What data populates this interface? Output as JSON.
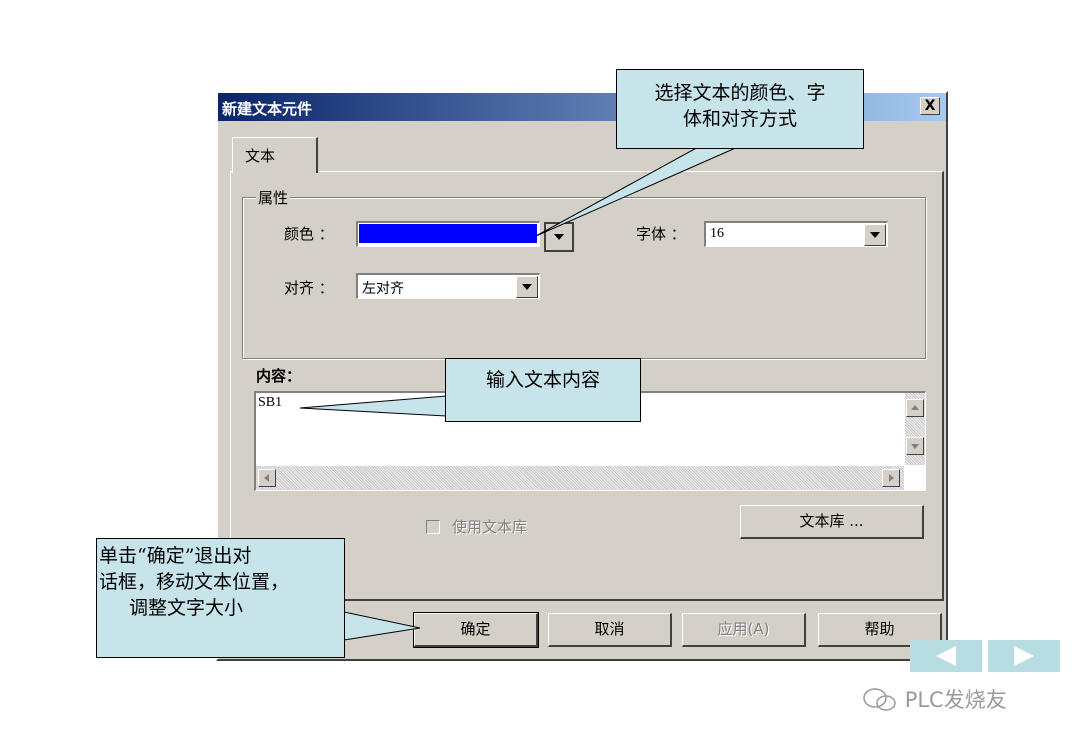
{
  "dialog": {
    "title": "新建文本元件",
    "close_label": "X",
    "tab_label": "文本",
    "properties": {
      "group_label": "属性",
      "color_label": "颜色 ：",
      "color_value": "#0000ff",
      "font_label": "字体 ：",
      "font_value": "16",
      "align_label": "对齐 ：",
      "align_value": "左对齐"
    },
    "content": {
      "label": "内容：",
      "value": "SB1"
    },
    "use_library_label": "使用文本库",
    "library_button": "文本库 ...",
    "buttons": {
      "ok": "确定",
      "cancel": "取消",
      "apply": "应用(A)",
      "help": "帮助"
    }
  },
  "callouts": {
    "style_line1": "选择文本的颜色、字",
    "style_line2": "体和对齐方式",
    "content": "输入文本内容",
    "confirm_line1": "单击“确定”退出对",
    "confirm_line2": "话框，移动文本位置，",
    "confirm_line3": "调整文字大小"
  },
  "nav": {
    "prev_icon": "triangle-left-icon",
    "next_icon": "triangle-right-icon"
  },
  "watermark": "PLC发烧友",
  "colors": {
    "callout_fill": "#c7e4ea",
    "dialog_bg": "#d4d0c8",
    "titlebar_start": "#0a246a",
    "titlebar_end": "#a6caf0",
    "nav_fill": "#b7dde3"
  }
}
